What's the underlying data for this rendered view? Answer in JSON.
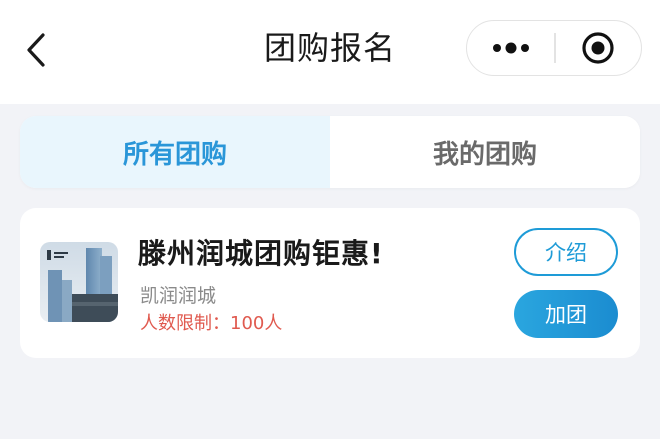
{
  "header": {
    "title": "团购报名",
    "back_icon": "chevron-left-icon",
    "more_icon": "more-dots-icon",
    "close_icon": "target-circle-icon"
  },
  "tabs": [
    {
      "label": "所有团购",
      "active": true
    },
    {
      "label": "我的团购",
      "active": false
    }
  ],
  "groupbuy": {
    "title": "滕州润城团购钜惠!",
    "subtitle": "凯润润城",
    "limit": "人数限制：100人",
    "thumbnail_icon": "building-thumbnail",
    "intro_label": "介绍",
    "join_label": "加团"
  },
  "colors": {
    "accent": "#1e9bd7",
    "active_tab_bg": "#e9f6fd",
    "limit_text": "#e05a4f",
    "page_bg": "#f2f3f7"
  }
}
